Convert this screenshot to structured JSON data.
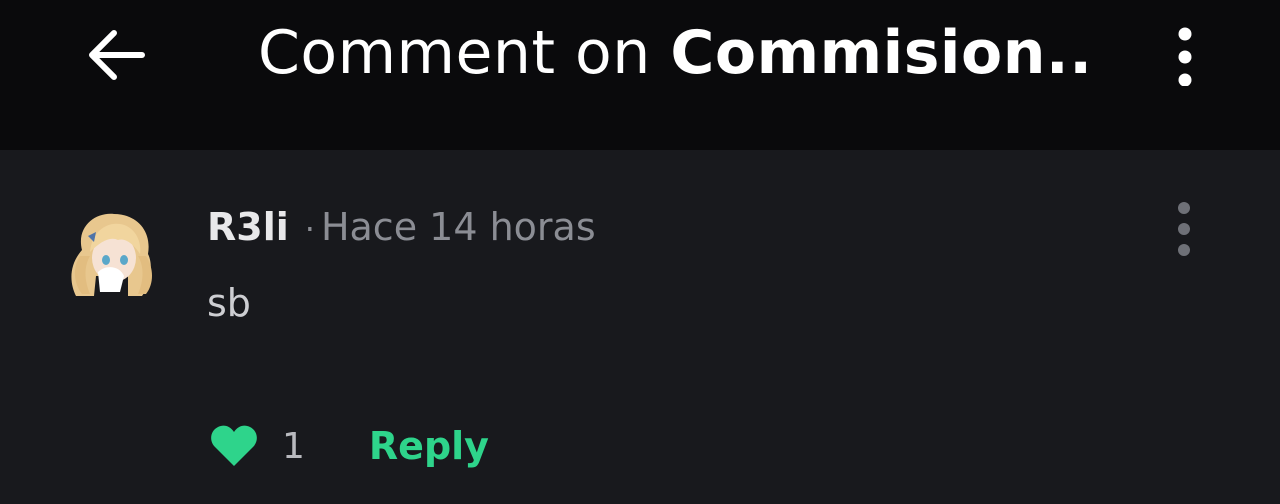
{
  "header": {
    "title_prefix": "Comment on ",
    "title_name": "Commision..",
    "back_icon": "arrow-left-icon",
    "menu_icon": "more-vertical-icon"
  },
  "comment": {
    "username": "R3li",
    "separator": "·",
    "timestamp": "Hace 14 horas",
    "text": "sb",
    "likes": "1",
    "reply_label": "Reply",
    "avatar_icon": "avatar",
    "menu_icon": "more-vertical-icon",
    "like_icon": "heart-icon"
  },
  "colors": {
    "header_bg": "#0a0a0c",
    "page_bg": "#18191d",
    "accent": "#2ed48b",
    "muted_text": "#8b8d94"
  }
}
